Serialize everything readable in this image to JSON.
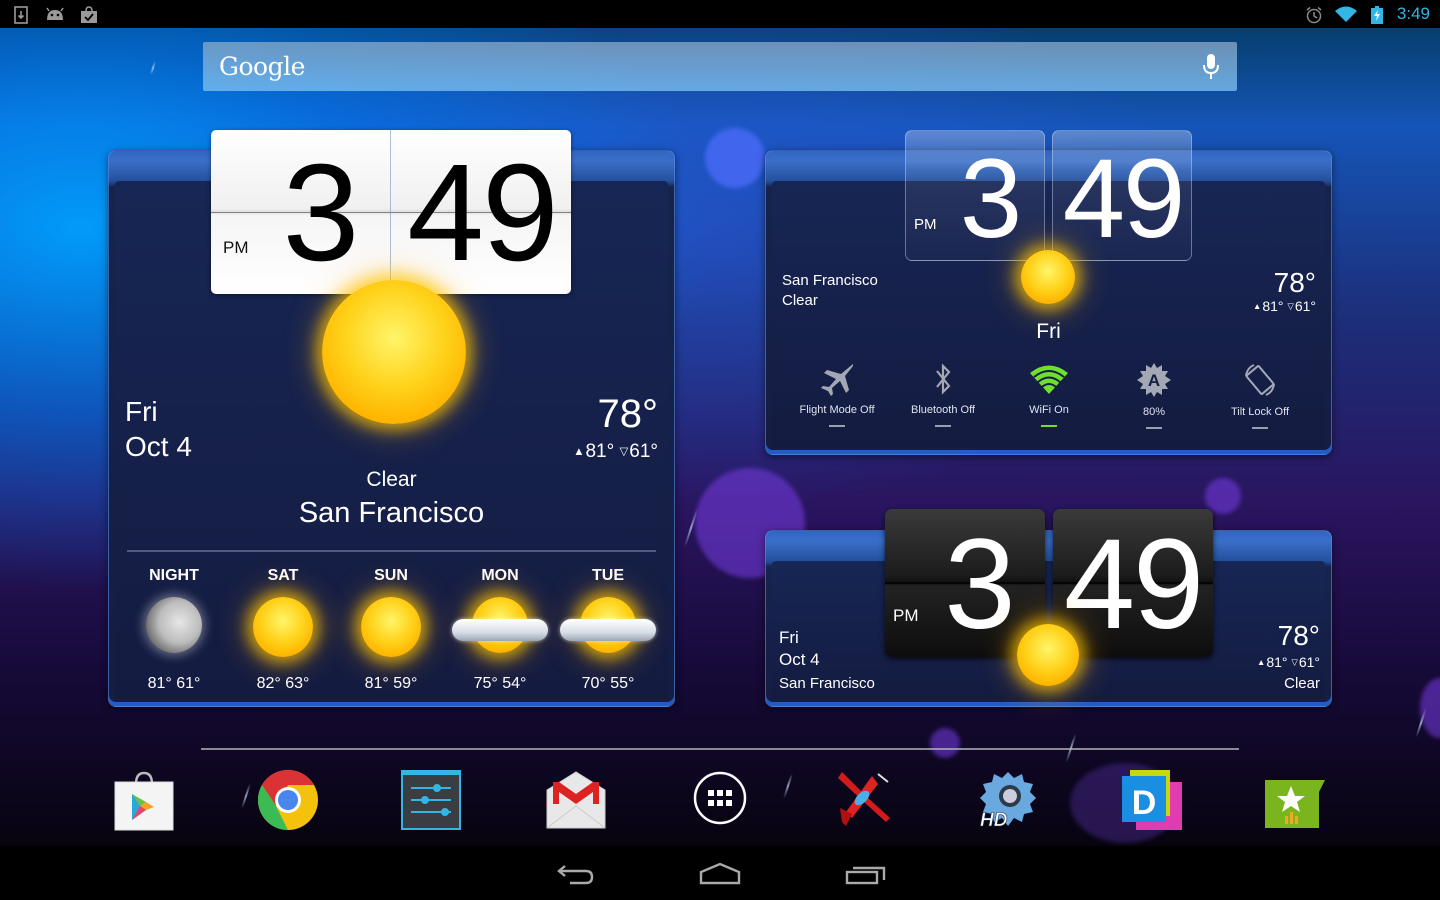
{
  "status_bar": {
    "left_icons": [
      "download-icon",
      "android-icon",
      "play-store-update-icon"
    ],
    "right_icons": [
      "alarm-icon",
      "wifi-signal-icon",
      "battery-charging-icon"
    ],
    "time": "3:49"
  },
  "search": {
    "logo": "Google",
    "mic_icon": "microphone-icon"
  },
  "widget_large": {
    "clock": {
      "hour": "3",
      "minute": "49",
      "ampm": "PM"
    },
    "day": "Fri",
    "date": "Oct 4",
    "temperature": "78°",
    "high": "81°",
    "low": "61°",
    "condition": "Clear",
    "city": "San Francisco",
    "forecast": [
      {
        "label": "NIGHT",
        "icon": "moon-icon",
        "temps": "81° 61°"
      },
      {
        "label": "SAT",
        "icon": "sun-icon",
        "temps": "82° 63°"
      },
      {
        "label": "SUN",
        "icon": "sun-icon",
        "temps": "81° 59°"
      },
      {
        "label": "MON",
        "icon": "partly-cloudy-icon",
        "temps": "75° 54°"
      },
      {
        "label": "TUE",
        "icon": "partly-cloudy-icon",
        "temps": "70° 55°"
      }
    ]
  },
  "widget_toggles": {
    "clock": {
      "hour": "3",
      "minute": "49",
      "ampm": "PM"
    },
    "city": "San Francisco",
    "condition": "Clear",
    "temperature": "78°",
    "high": "81°",
    "low": "61°",
    "day": "Fri",
    "toggles": [
      {
        "label": "Flight Mode Off",
        "icon": "airplane-icon",
        "state": "off"
      },
      {
        "label": "Bluetooth Off",
        "icon": "bluetooth-icon",
        "state": "off"
      },
      {
        "label": "WiFi On",
        "icon": "wifi-icon",
        "state": "on"
      },
      {
        "label": "80%",
        "icon": "auto-brightness-icon",
        "state": "off"
      },
      {
        "label": "Tilt Lock Off",
        "icon": "rotation-lock-icon",
        "state": "off"
      }
    ],
    "on_color": "#6fe02e",
    "off_color": "#9aa0ae"
  },
  "widget_dark": {
    "clock": {
      "hour": "3",
      "minute": "49",
      "ampm": "PM"
    },
    "day": "Fri",
    "date": "Oct 4",
    "city": "San Francisco",
    "temperature": "78°",
    "high": "81°",
    "low": "61°",
    "condition": "Clear"
  },
  "dock": {
    "apps": [
      {
        "name": "Play Store",
        "icon": "play-store-icon"
      },
      {
        "name": "Chrome",
        "icon": "chrome-icon"
      },
      {
        "name": "Settings",
        "icon": "settings-sliders-icon"
      },
      {
        "name": "Gmail",
        "icon": "gmail-icon"
      },
      {
        "name": "All Apps",
        "icon": "app-drawer-icon"
      },
      {
        "name": "Plane Game",
        "icon": "red-plane-icon"
      },
      {
        "name": "HD Widgets",
        "icon": "hd-gear-icon"
      },
      {
        "name": "D App",
        "icon": "d-app-icon"
      },
      {
        "name": "Market Stats",
        "icon": "star-chart-icon"
      }
    ]
  },
  "nav": {
    "back": "back-icon",
    "home": "home-icon",
    "recents": "recents-icon"
  },
  "colors": {
    "status_time": "#33b5e5",
    "panel_accent": "#1f5ec8",
    "wifi_on": "#6fe02e"
  }
}
